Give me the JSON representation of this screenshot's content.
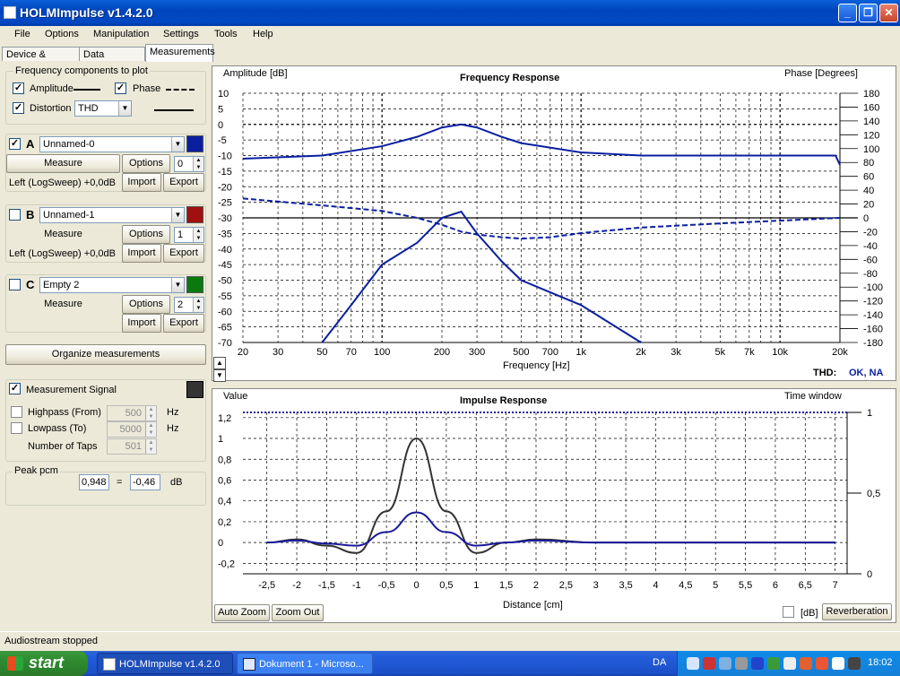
{
  "window": {
    "title": "HOLMImpulse  v1.4.2.0"
  },
  "menu": [
    "File",
    "Options",
    "Manipulation",
    "Settings",
    "Tools",
    "Help"
  ],
  "tabs": [
    "Device & Signal",
    "Data analysis",
    "Measurements"
  ],
  "freq_components": {
    "label": "Frequency components to plot",
    "amplitude": "Amplitude",
    "phase": "Phase",
    "distortion": "Distortion",
    "distortion_value": "THD",
    "amp_checked": "✓",
    "phase_checked": "✓",
    "dist_checked": "✓"
  },
  "measurements": [
    {
      "letter": "A",
      "name": "Unnamed-0",
      "color": "#0a1fa0",
      "checked": "✓",
      "index": "0",
      "info": "Left (LogSweep) +0,0dB"
    },
    {
      "letter": "B",
      "name": "Unnamed-1",
      "color": "#a01010",
      "checked": "",
      "index": "1",
      "info": "Left (LogSweep) +0,0dB"
    },
    {
      "letter": "C",
      "name": "Empty 2",
      "color": "#0a7a10",
      "checked": "",
      "index": "2",
      "info": ""
    }
  ],
  "buttons": {
    "measure": "Measure",
    "options": "Options",
    "import": "Import",
    "export": "Export",
    "organize": "Organize measurements",
    "auto_zoom": "Auto Zoom",
    "zoom_out": "Zoom Out",
    "reverberation": "Reverberation"
  },
  "signal": {
    "label": "Measurement Signal",
    "checked": "✓",
    "highpass": "Highpass (From)",
    "highpass_value": "500",
    "lowpass": "Lowpass (To)",
    "lowpass_value": "5000",
    "taps": "Number of Taps",
    "taps_value": "501",
    "hz": "Hz"
  },
  "peak": {
    "label": "Peak pcm",
    "pcm": "0,948",
    "eq": "=",
    "db_value": "-0,46",
    "db": "dB"
  },
  "freq_plot": {
    "title": "Frequency Response",
    "ylabel_left": "Amplitude [dB]",
    "ylabel_right": "Phase [Degrees]",
    "xlabel": "Frequency [Hz]",
    "thd_label": "THD:",
    "thd_status": "OK, NA",
    "y_ticks": [
      "10",
      "5",
      "0",
      "-5",
      "-10",
      "-15",
      "-20",
      "-25",
      "-30",
      "-35",
      "-40",
      "-45",
      "-50",
      "-55",
      "-60",
      "-65",
      "-70"
    ],
    "phase_ticks": [
      "180",
      "160",
      "140",
      "120",
      "100",
      "80",
      "60",
      "40",
      "20",
      "0",
      "-20",
      "-40",
      "-60",
      "-80",
      "-100",
      "-120",
      "-140",
      "-160",
      "-180"
    ],
    "x_ticks": [
      "20",
      "30",
      "50",
      "70",
      "100",
      "200",
      "300",
      "500",
      "700",
      "1k",
      "2k",
      "3k",
      "5k",
      "7k",
      "10k",
      "20k"
    ]
  },
  "imp_plot": {
    "title": "Impulse Response",
    "ylabel_left": "Value",
    "ylabel_right": "Time window",
    "xlabel": "Distance [cm]",
    "y_ticks": [
      "1,2",
      "1",
      "0,8",
      "0,6",
      "0,4",
      "0,2",
      "0",
      "-0,2"
    ],
    "right_ticks": [
      "1",
      "0,5",
      "0"
    ],
    "x_ticks": [
      "-2,5",
      "-2",
      "-1,5",
      "-1",
      "-0,5",
      "0",
      "0,5",
      "1",
      "1,5",
      "2",
      "2,5",
      "3",
      "3,5",
      "4",
      "4,5",
      "5",
      "5,5",
      "6",
      "6,5",
      "7"
    ],
    "db_label": "[dB]"
  },
  "chart_data": [
    {
      "type": "line",
      "title": "Frequency Response",
      "xlabel": "Frequency [Hz]",
      "ylabel": "Amplitude [dB]",
      "xscale": "log",
      "xlim": [
        20,
        20000
      ],
      "ylim": [
        -70,
        10
      ],
      "y2label": "Phase [Degrees]",
      "y2lim": [
        -180,
        180
      ],
      "series": [
        {
          "x": [
            20,
            50,
            100,
            150,
            200,
            250,
            300,
            400,
            500,
            1000,
            2000,
            5000,
            10000,
            18000,
            19000,
            20000
          ],
          "values": [
            -11,
            -10,
            -7,
            -4,
            -1,
            0,
            -1,
            -4,
            -6,
            -9,
            -10,
            -10,
            -10,
            -10,
            -10,
            -13
          ],
          "axis": "left",
          "style": "solid"
        },
        {
          "x": [
            20,
            50,
            100,
            150,
            200,
            250,
            300,
            400,
            500,
            700,
            1000,
            2000,
            5000,
            10000,
            20000
          ],
          "values": [
            28,
            18,
            10,
            0,
            -10,
            -20,
            -24,
            -28,
            -30,
            -28,
            -22,
            -14,
            -8,
            -4,
            0
          ],
          "axis": "right",
          "style": "dashed"
        },
        {
          "x": [
            50,
            70,
            100,
            150,
            200,
            250,
            300,
            400,
            500,
            1000,
            2000
          ],
          "values": [
            -70,
            -58,
            -45,
            -38,
            -30,
            -28,
            -35,
            -44,
            -50,
            -58,
            -70
          ],
          "axis": "left",
          "style": "solid"
        }
      ]
    },
    {
      "type": "line",
      "title": "Impulse Response",
      "xlabel": "Distance [cm]",
      "ylabel": "Value",
      "xlim": [
        -2.5,
        7
      ],
      "ylim": [
        -0.2,
        1.2
      ],
      "y2label": "Time window",
      "series": [
        {
          "x": [
            -2.5,
            -2,
            -1.5,
            -1,
            -0.5,
            0,
            0.5,
            1,
            1.5,
            2,
            3,
            4,
            5,
            6,
            7
          ],
          "values": [
            0,
            0.03,
            -0.03,
            -0.1,
            0.3,
            1,
            0.3,
            -0.1,
            0,
            0.03,
            0,
            0,
            0,
            0,
            0
          ],
          "color": "#333333"
        },
        {
          "x": [
            -2.5,
            -2,
            -1.5,
            -1,
            -0.5,
            0,
            0.5,
            1,
            1.5,
            2,
            3,
            4,
            5,
            6,
            7
          ],
          "values": [
            0,
            0.02,
            -0.01,
            -0.03,
            0.1,
            0.29,
            0.1,
            -0.03,
            0,
            0.02,
            0,
            0,
            0,
            0,
            0
          ],
          "color": "#1a1a9a"
        },
        {
          "x": [
            -2.5,
            7
          ],
          "values": [
            1.2,
            1.2
          ],
          "color": "#1a1a9a",
          "style": "dotted"
        }
      ]
    }
  ],
  "status": {
    "text": "Audiostream stopped"
  },
  "taskbar": {
    "start": "start",
    "tasks": [
      "HOLMImpulse  v1.4.2.0",
      "Dokument 1 - Microso..."
    ],
    "lang": "DA",
    "clock": "18:02"
  }
}
